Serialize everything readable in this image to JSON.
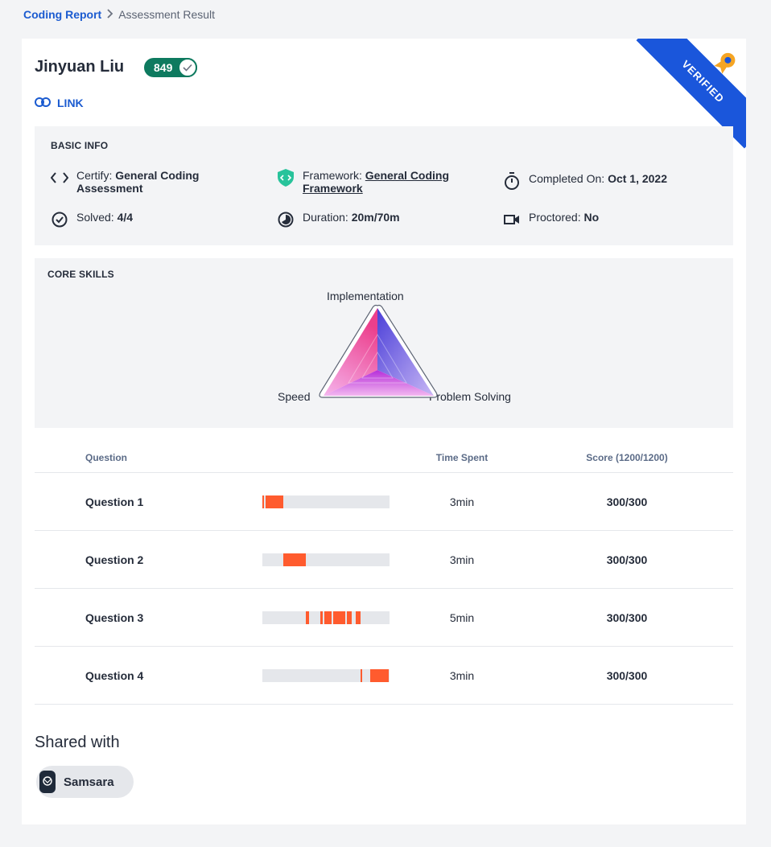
{
  "breadcrumb": {
    "root": "Coding Report",
    "current": "Assessment Result"
  },
  "candidate": {
    "name": "Jinyuan Liu",
    "score": "849",
    "link_label": "LINK"
  },
  "ribbon": {
    "label": "VERIFIED"
  },
  "basic_info": {
    "title": "BASIC INFO",
    "certify_label": "Certify:",
    "certify_value": "General Coding Assessment",
    "framework_label": "Framework:",
    "framework_value": "General Coding Framework",
    "completed_label": "Completed On:",
    "completed_value": "Oct 1, 2022",
    "solved_label": "Solved:",
    "solved_value": "4/4",
    "duration_label": "Duration:",
    "duration_value": "20m/70m",
    "proctored_label": "Proctored:",
    "proctored_value": "No"
  },
  "core_skills": {
    "title": "CORE SKILLS",
    "axes": [
      "Implementation",
      "Problem Solving",
      "Speed"
    ]
  },
  "table": {
    "headers": {
      "question": "Question",
      "time": "Time Spent",
      "score": "Score (1200/1200)"
    },
    "rows": [
      {
        "question": "Question 1",
        "time": "3min",
        "score": "300/300"
      },
      {
        "question": "Question 2",
        "time": "3min",
        "score": "300/300"
      },
      {
        "question": "Question 3",
        "time": "5min",
        "score": "300/300"
      },
      {
        "question": "Question 4",
        "time": "3min",
        "score": "300/300"
      }
    ]
  },
  "shared": {
    "title": "Shared with",
    "company": "Samsara"
  },
  "colors": {
    "accent": "#1b5bd0",
    "score_pill": "#0e7a5f",
    "ribbon": "#1a56db",
    "activity": "#ff5b2e"
  },
  "icons": {
    "link": "link-icon",
    "certify": "code-brackets-icon",
    "framework": "shield-code-icon",
    "completed": "stopwatch-icon",
    "solved": "check-circle-icon",
    "duration": "clock-half-icon",
    "proctored": "video-camera-icon",
    "badge": "ribbon-badge-icon"
  }
}
